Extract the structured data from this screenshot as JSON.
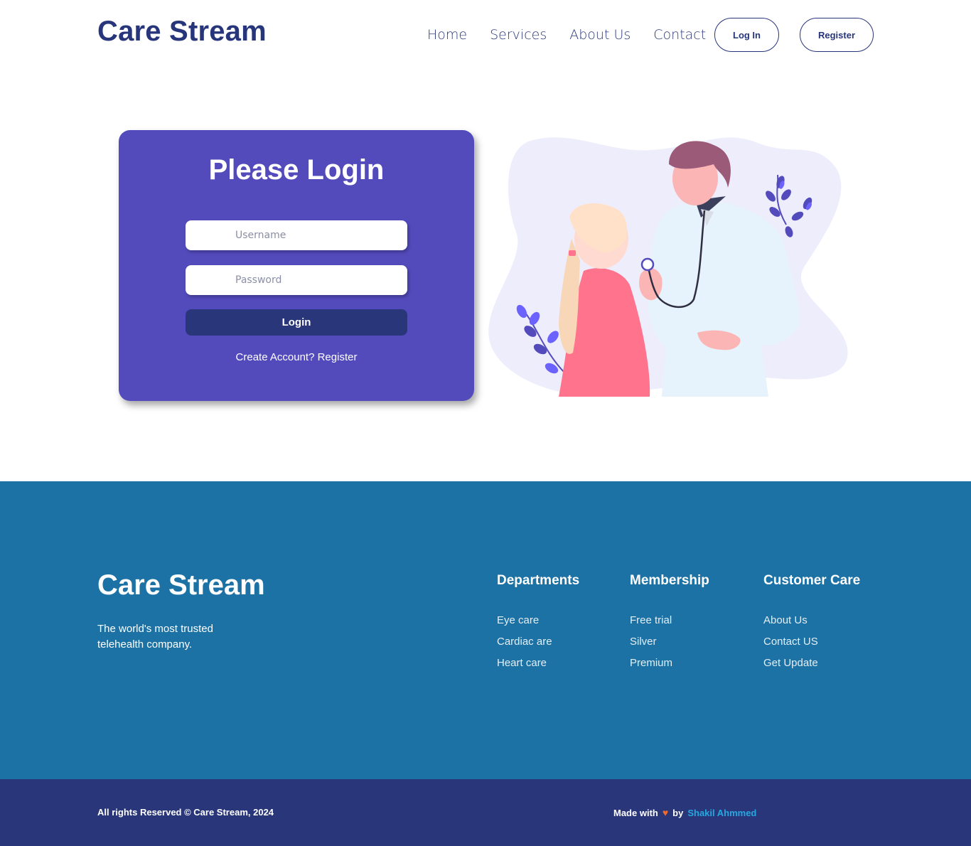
{
  "header": {
    "brand": "Care Stream",
    "nav": [
      "Home",
      "Services",
      "About Us",
      "Contact"
    ],
    "login_label": "Log In",
    "register_label": "Register"
  },
  "login": {
    "title": "Please Login",
    "username_placeholder": "Username",
    "password_placeholder": "Password",
    "submit_label": "Login",
    "create_account": "Create Account? Register"
  },
  "footer": {
    "brand": "Care Stream",
    "tagline": "The world's most trusted telehealth company.",
    "columns": [
      {
        "title": "Departments",
        "items": [
          "Eye care",
          "Cardiac are",
          "Heart care"
        ]
      },
      {
        "title": "Membership",
        "items": [
          "Free trial",
          "Silver",
          "Premium"
        ]
      },
      {
        "title": "Customer Care",
        "items": [
          "About Us",
          "Contact US",
          "Get Update"
        ]
      }
    ],
    "rights": "All rights Reserved © Care Stream, 2024",
    "made_with": "Made with",
    "by": "by",
    "author": "Shakil Ahmmed"
  },
  "colors": {
    "primary": "#27357a",
    "card": "#534bbc",
    "footer": "#1c72a4",
    "bottom_bar": "#29367a",
    "accent_link": "#25a8e0",
    "heart": "#ef6a2a"
  },
  "icons": {
    "heart": "heart-icon"
  }
}
